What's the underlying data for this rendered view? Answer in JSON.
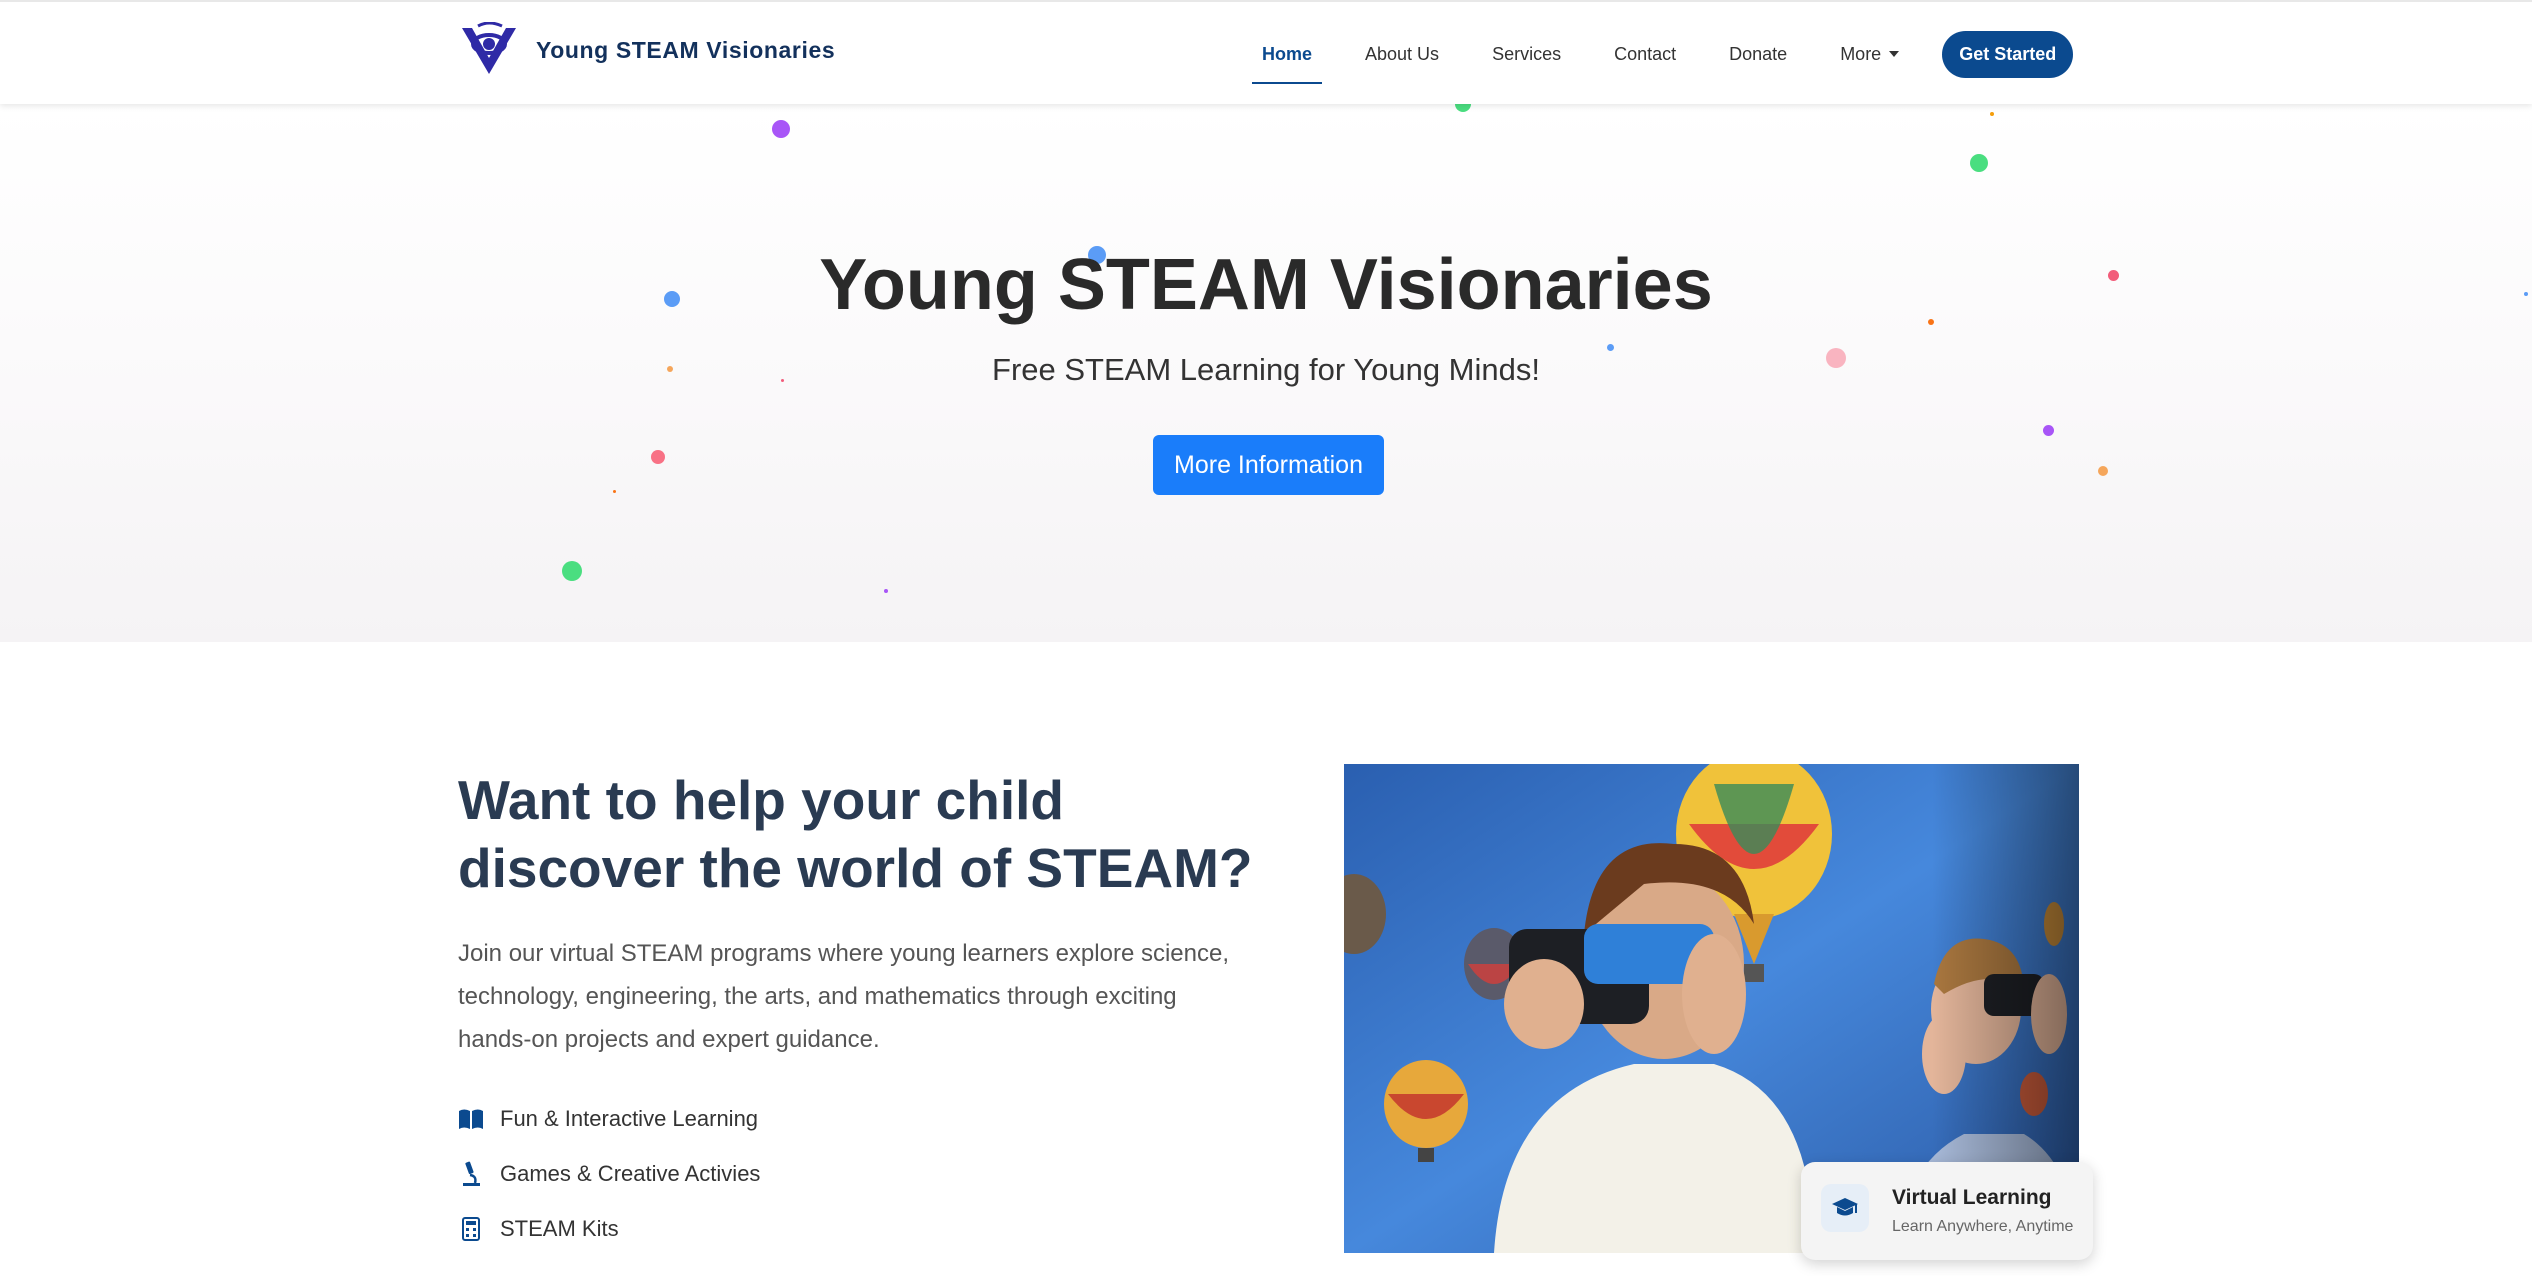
{
  "brand": {
    "name": "Young STEAM Visionaries"
  },
  "nav": {
    "items": [
      {
        "label": "Home",
        "active": true
      },
      {
        "label": "About Us"
      },
      {
        "label": "Services"
      },
      {
        "label": "Contact"
      },
      {
        "label": "Donate"
      },
      {
        "label": "More",
        "dropdown": true
      }
    ],
    "cta": "Get Started"
  },
  "hero": {
    "title": "Young STEAM Visionaries",
    "subtitle": "Free STEAM Learning for Young Minds!",
    "button": "More Information"
  },
  "intro": {
    "title_line1": "Want to help your child",
    "title_line2": "discover the world of STEAM?",
    "description_lines": [
      "Join our virtual STEAM programs where young learners explore science,",
      "technology, engineering, the arts, and mathematics through exciting",
      "hands-on projects and expert guidance."
    ],
    "features": [
      {
        "icon": "book-icon",
        "label": "Fun & Interactive Learning"
      },
      {
        "icon": "microscope-icon",
        "label": "Games & Creative Activies"
      },
      {
        "icon": "calculator-icon",
        "label": "STEAM Kits"
      }
    ]
  },
  "badge": {
    "icon": "graduation-cap-icon",
    "title": "Virtual Learning",
    "subtitle": "Learn Anywhere, Anytime"
  },
  "colors": {
    "brand": "#13315c",
    "primary": "#0b4a8f",
    "hero_button": "#1a7dfa"
  }
}
